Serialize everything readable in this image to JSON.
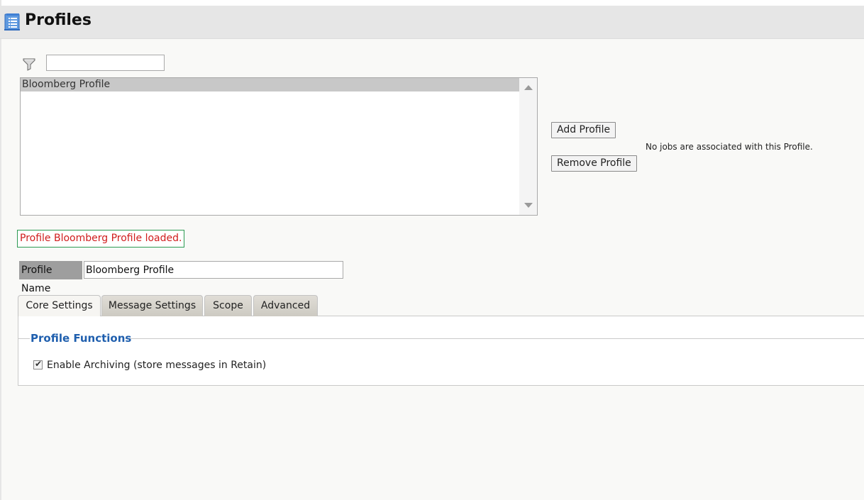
{
  "header": {
    "title": "Profiles",
    "icon": "list-document-icon"
  },
  "filter": {
    "icon": "funnel-filter-icon",
    "value": ""
  },
  "profile_list": {
    "items": [
      {
        "label": "Bloomberg Profile",
        "selected": true
      }
    ]
  },
  "actions": {
    "add_label": "Add Profile",
    "remove_label": "Remove Profile"
  },
  "jobs_note": "No jobs are associated with this Profile.",
  "status_message": "Profile Bloomberg Profile loaded.",
  "profile_name": {
    "label": "Profile Name",
    "value": "Bloomberg Profile"
  },
  "tabs": [
    {
      "label": "Core Settings",
      "active": true
    },
    {
      "label": "Message Settings",
      "active": false
    },
    {
      "label": "Scope",
      "active": false
    },
    {
      "label": "Advanced",
      "active": false
    }
  ],
  "profile_functions": {
    "legend": "Profile Functions",
    "archiving": {
      "label": "Enable Archiving (store messages in Retain)",
      "checked": true
    }
  },
  "colors": {
    "legend_blue": "#1f5fae",
    "status_red": "#d01c1c",
    "status_border_green": "#2c9a52"
  }
}
